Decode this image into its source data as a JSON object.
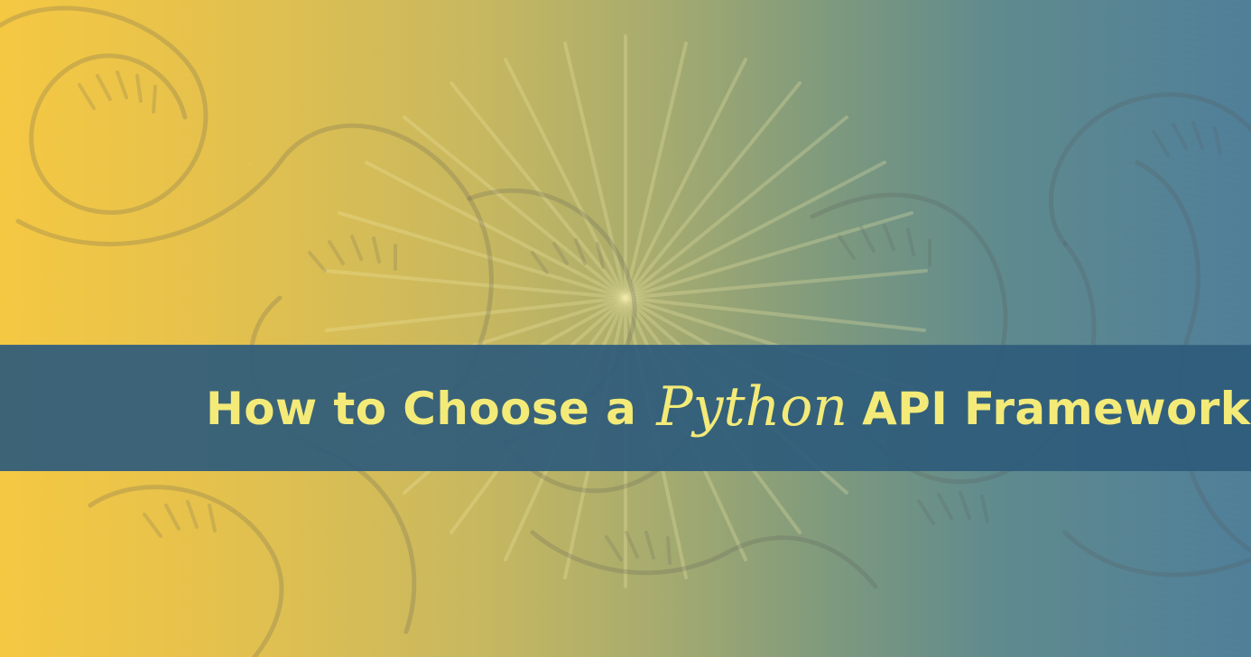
{
  "hero": {
    "title_prefix": "How to Choose a",
    "title_highlight": "Python",
    "title_suffix": "API Framework"
  },
  "colors": {
    "left_yellow": "#f5c842",
    "right_blue": "#4f7f99",
    "banner_blue": "#2e5b7b",
    "title_yellow": "#f3ea78"
  },
  "icons": {
    "background_snake": "snake-illustration-icon",
    "background_sunburst": "sunburst-icon"
  }
}
